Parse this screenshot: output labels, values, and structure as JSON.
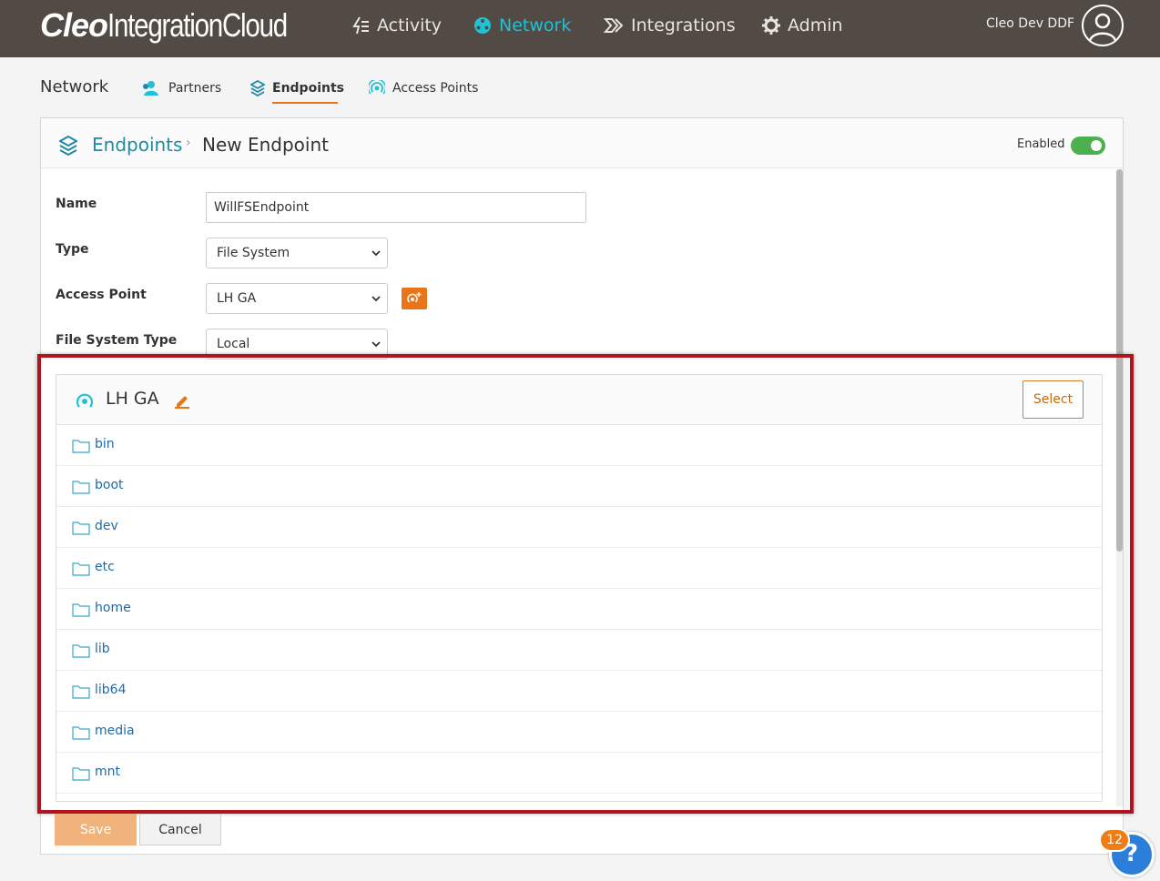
{
  "brand": {
    "cleo": "Cleo",
    "product": "IntegrationCloud"
  },
  "topnav": [
    {
      "label": "Activity",
      "icon": "activity-icon"
    },
    {
      "label": "Network",
      "icon": "network-icon",
      "active": true
    },
    {
      "label": "Integrations",
      "icon": "integrations-icon"
    },
    {
      "label": "Admin",
      "icon": "gear-icon"
    }
  ],
  "user": {
    "name": "Cleo Dev DDF"
  },
  "subnav": {
    "title": "Network",
    "items": [
      {
        "label": "Partners",
        "icon": "partners-icon"
      },
      {
        "label": "Endpoints",
        "icon": "layers-icon",
        "active": true
      },
      {
        "label": "Access Points",
        "icon": "access-point-icon"
      }
    ]
  },
  "card": {
    "breadcrumb_link": "Endpoints",
    "breadcrumb_current": "New Endpoint",
    "enabled_label": "Enabled",
    "enabled": true
  },
  "form": {
    "name_label": "Name",
    "name_value": "WillFSEndpoint",
    "type_label": "Type",
    "type_value": "File System",
    "access_point_label": "Access Point",
    "access_point_value": "LH GA",
    "fs_type_label": "File System Type",
    "fs_type_value": "Local"
  },
  "browser": {
    "title": "LH GA",
    "select_label": "Select",
    "folders": [
      "bin",
      "boot",
      "dev",
      "etc",
      "home",
      "lib",
      "lib64",
      "media",
      "mnt"
    ]
  },
  "buttons": {
    "save": "Save",
    "cancel": "Cancel"
  },
  "help": {
    "badge": "12",
    "glyph": "?"
  },
  "colors": {
    "topbar": "#524a44",
    "accent": "#1fc2d6",
    "orange": "#e8751a",
    "link": "#1f6aa6",
    "highlight": "#b0141c"
  }
}
